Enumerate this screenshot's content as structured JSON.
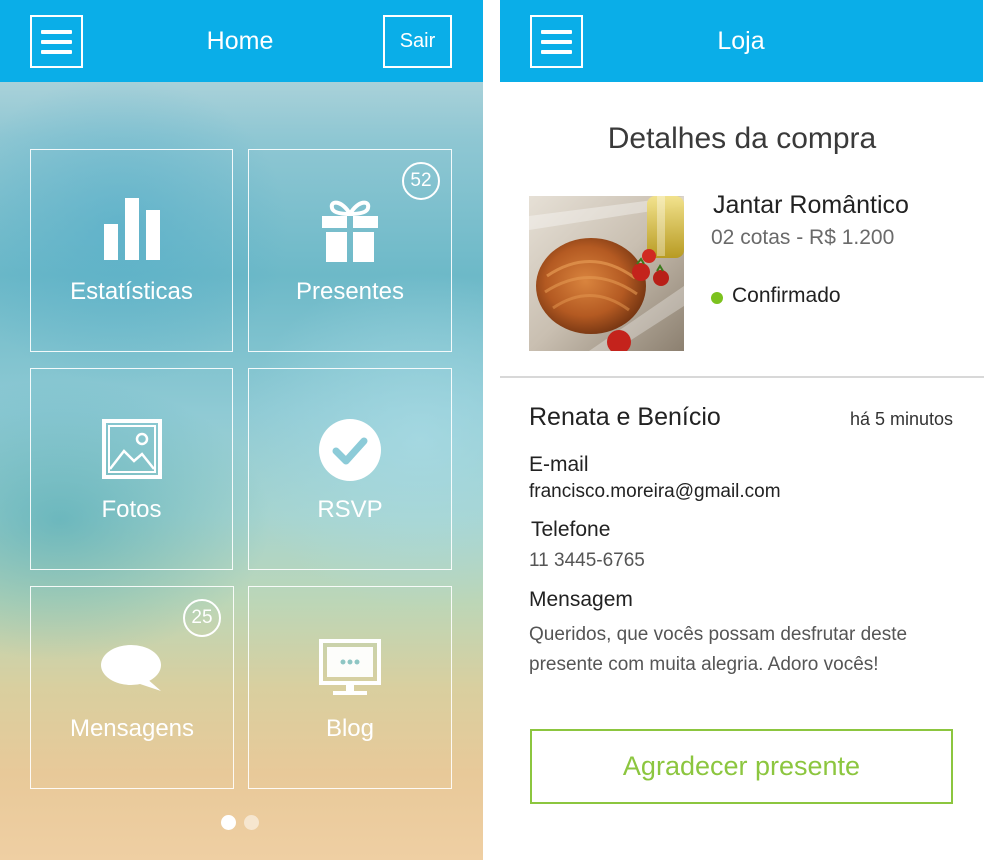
{
  "home": {
    "title": "Home",
    "logout_label": "Sair",
    "tiles": [
      {
        "label": "Estatísticas",
        "icon": "bar-chart-icon"
      },
      {
        "label": "Presentes",
        "icon": "gift-icon",
        "badge": "52"
      },
      {
        "label": "Fotos",
        "icon": "image-icon"
      },
      {
        "label": "RSVP",
        "icon": "checkmark-icon"
      },
      {
        "label": "Mensagens",
        "icon": "speech-bubble-icon",
        "badge": "25"
      },
      {
        "label": "Blog",
        "icon": "monitor-icon"
      }
    ],
    "pagination": {
      "pages": 2,
      "current": 1
    }
  },
  "store": {
    "title": "Loja",
    "section_title": "Detalhes da compra",
    "product": {
      "name": "Jantar Romântico",
      "quantity_price": "02 cotas - R$ 1.200",
      "status": "Confirmado",
      "status_color": "#7cc21e"
    },
    "buyer": {
      "name": "Renata e Benício",
      "time": "há 5 minutos",
      "email_label": "E-mail",
      "email": "francisco.moreira@gmail.com",
      "phone_label": "Telefone",
      "phone": "11 3445-6765",
      "message_label": "Mensagem",
      "message": "Queridos, que vocês possam desfrutar deste presente com muita alegria. Adoro vocês!"
    },
    "thank_button_label": "Agradecer presente"
  },
  "colors": {
    "header": "#0aaee8",
    "accent_green": "#8cc63f"
  }
}
